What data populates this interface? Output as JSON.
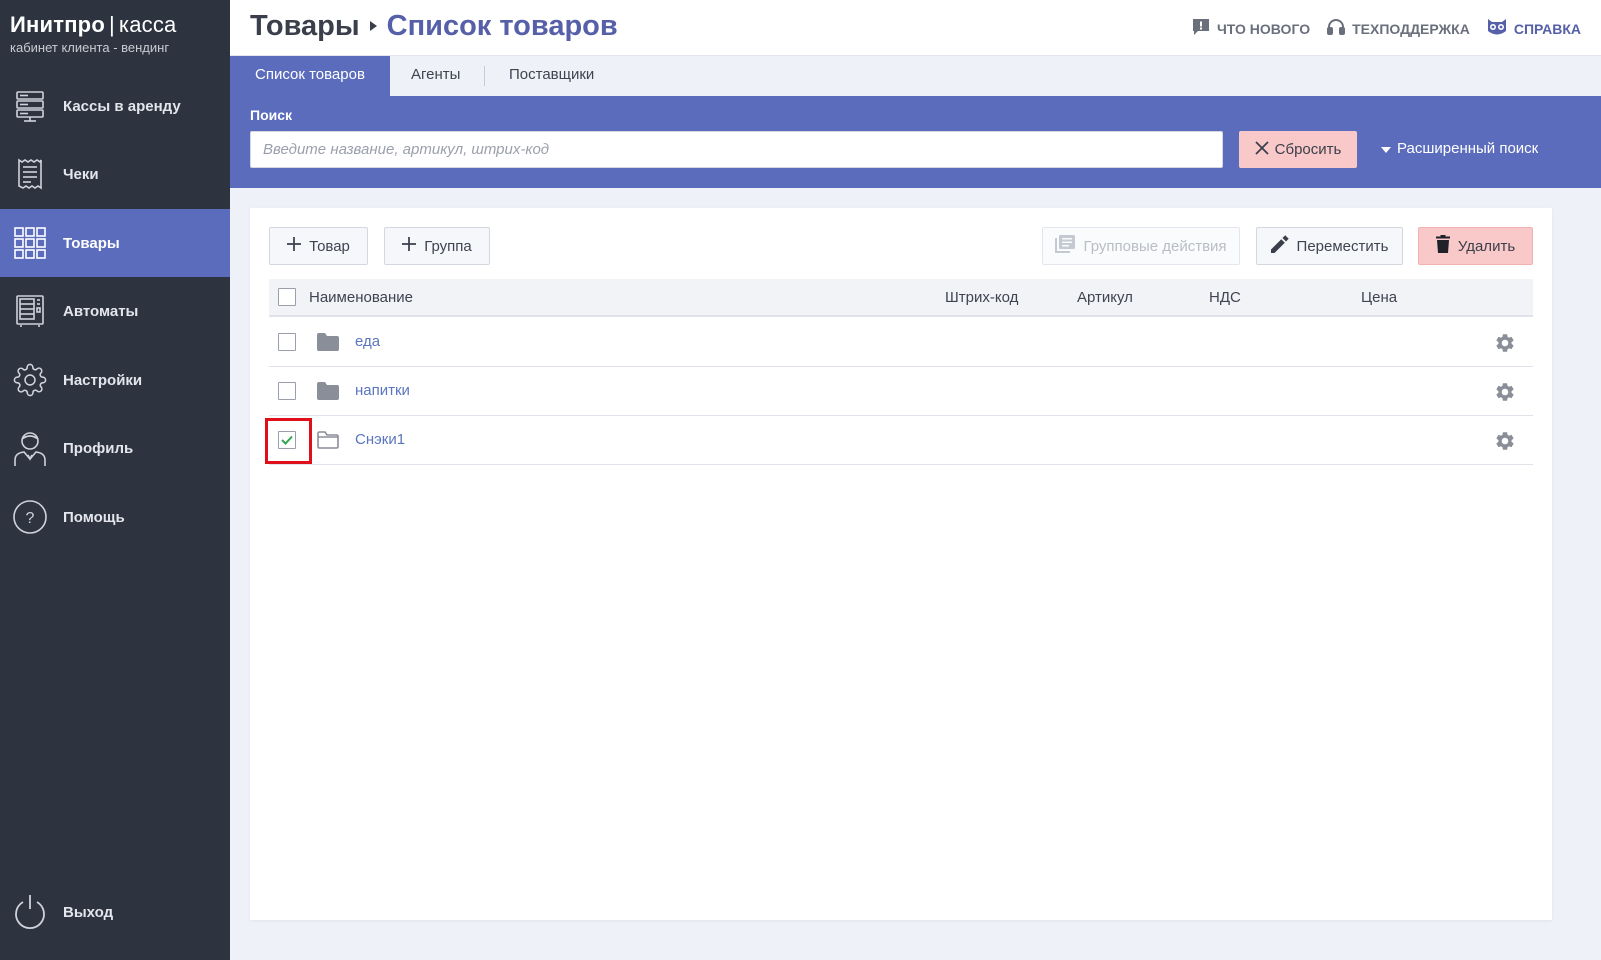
{
  "sidebar": {
    "brand_name": "Инитпро",
    "brand_separator": "|",
    "brand_product": "касса",
    "brand_subtitle": "кабинет клиента - вендинг",
    "items": [
      {
        "label": "Кассы в аренду",
        "icon": "server-icon",
        "active": false
      },
      {
        "label": "Чеки",
        "icon": "receipt-icon",
        "active": false
      },
      {
        "label": "Товары",
        "icon": "grid-icon",
        "active": true
      },
      {
        "label": "Автоматы",
        "icon": "vending-machine-icon",
        "active": false
      },
      {
        "label": "Настройки",
        "icon": "gear-icon",
        "active": false
      },
      {
        "label": "Профиль",
        "icon": "user-icon",
        "active": false
      },
      {
        "label": "Помощь",
        "icon": "help-icon",
        "active": false
      }
    ],
    "logout_label": "Выход"
  },
  "header": {
    "breadcrumb_root": "Товары",
    "breadcrumb_current": "Список товаров",
    "links": {
      "whats_new": "ЧТО НОВОГО",
      "support": "ТЕХПОДДЕРЖКА",
      "help": "СПРАВКА"
    }
  },
  "tabs": [
    "Список товаров",
    "Агенты",
    "Поставщики"
  ],
  "search": {
    "label": "Поиск",
    "placeholder": "Введите название, артикул, штрих-код",
    "value": "",
    "reset_label": "Сбросить",
    "advanced_label": "Расширенный поиск"
  },
  "toolbar": {
    "add_product": "Товар",
    "add_group": "Группа",
    "group_actions": "Групповые действия",
    "move": "Переместить",
    "delete": "Удалить"
  },
  "table": {
    "columns": [
      "Наименование",
      "Штрих-код",
      "Артикул",
      "НДС",
      "Цена"
    ],
    "rows": [
      {
        "name": "еда",
        "checked": false,
        "folder_style": "filled"
      },
      {
        "name": "напитки",
        "checked": false,
        "folder_style": "filled"
      },
      {
        "name": "Снэки1",
        "checked": true,
        "folder_style": "outline"
      }
    ]
  },
  "colors": {
    "sidebar_bg": "#2d333f",
    "accent": "#5b6cbc",
    "link": "#5b76c0",
    "danger_bg": "#f9c8c8",
    "highlight_box": "#e0101a",
    "check_green": "#2fa84f"
  }
}
